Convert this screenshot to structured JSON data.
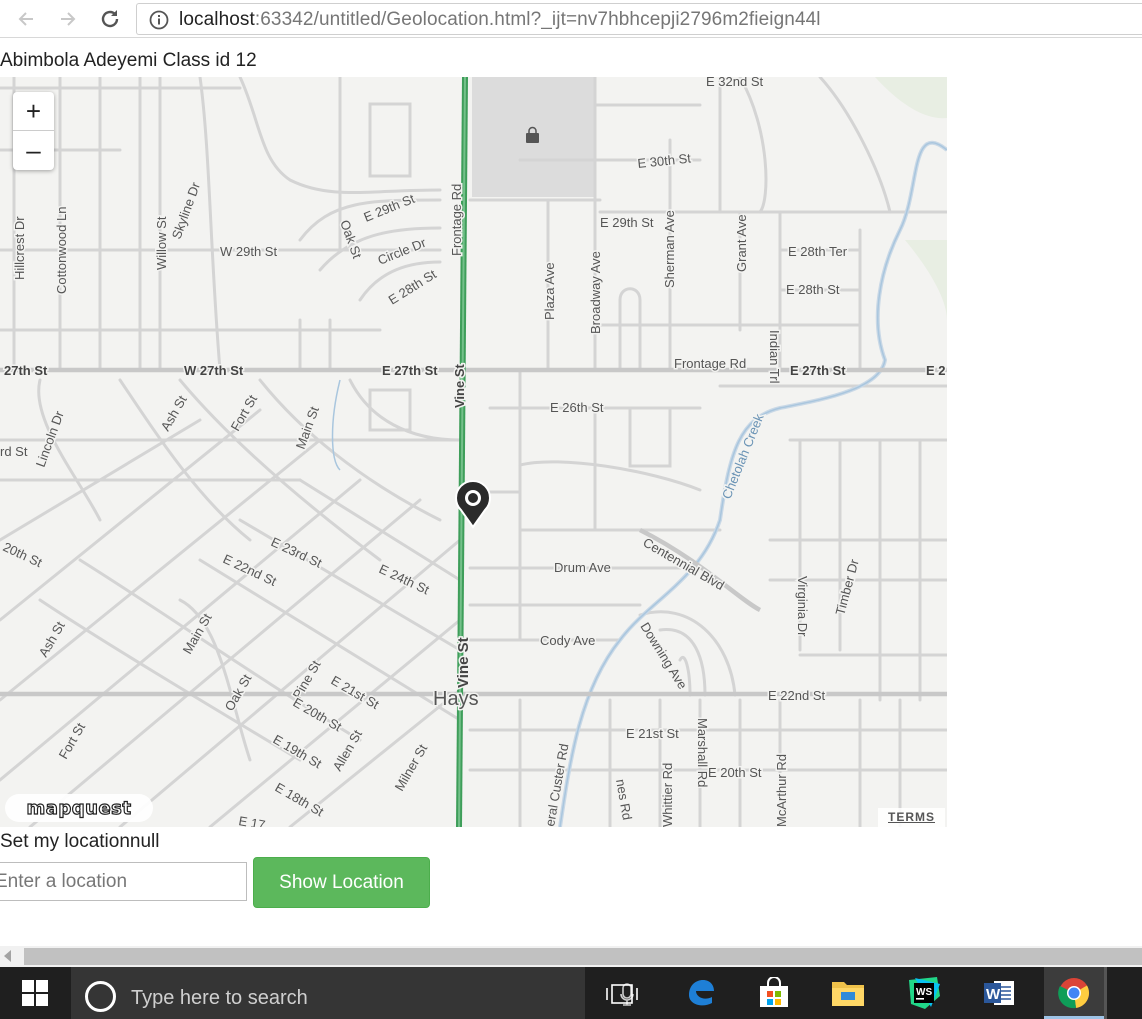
{
  "browser": {
    "url_host": "localhost",
    "url_rest": ":63342/untitled/Geolocation.html?_ijt=nv7hbhcepji2796m2fieign44l",
    "back_icon": "arrow-left-icon",
    "forward_icon": "arrow-right-icon",
    "reload_icon": "reload-icon",
    "info_icon": "info-circle-icon"
  },
  "page": {
    "heading": "Abimbola Adeyemi Class id 12",
    "set_location_text": "Set my locationnull",
    "location_input_placeholder": "Enter a location",
    "show_location_label": "Show Location"
  },
  "map": {
    "provider_logo": "mapquest",
    "terms_label": "TERMS",
    "zoom_in_label": "+",
    "zoom_out_label": "–",
    "city_label": "Hays",
    "street_labels": [
      "E 32nd St",
      "E 30th St",
      "E 29th St",
      "E 29th St",
      "Circle Dr",
      "E 28th St",
      "W 29th St",
      "E 28th Ter",
      "E 28th St",
      "Hillcrest Dr",
      "Cottonwood Ln",
      "Willow St",
      "Skyline Dr",
      "Oak St",
      "Frontage Rd",
      "Plaza Ave",
      "Broadway Ave",
      "Sherman Ave",
      "Grant Ave",
      "27th St",
      "W 27th St",
      "E 27th St",
      "Frontage Rd",
      "E 27th St",
      "Indian Trl",
      "E 26th St",
      "Chetolah Creek",
      "Lincoln Dr",
      "Ash St",
      "Fort St",
      "Main St",
      "Vine St",
      "E 23rd St",
      "E 24th St",
      "E 22nd St",
      "Drum Ave",
      "Centennial Blvd",
      "Cody Ave",
      "Downing Ave",
      "Virginia Dr",
      "Timber Dr",
      "Vine St",
      "E 22nd St",
      "E 21st St",
      "E 20th St",
      "Marshall Rd",
      "Whittier Rd",
      "McArthur Rd",
      "Oak St",
      "Pine St",
      "E 21st St",
      "E 20th St",
      "Allen St",
      "E 19th St",
      "Milner St",
      "E 18th St",
      "Ash St",
      "Main St",
      "Fort St",
      "20th St",
      "rd St",
      "E 2",
      "E 17",
      "eral Custer Rd",
      "nes Rd"
    ],
    "marker_icon": "location-pin-icon"
  },
  "taskbar": {
    "search_placeholder": "Type here to search",
    "start_icon": "windows-start-icon",
    "cortana_icon": "cortana-circle-icon",
    "mic_icon": "microphone-icon",
    "task_view_icon": "task-view-icon",
    "apps": [
      {
        "name": "edge-icon",
        "label": "e"
      },
      {
        "name": "store-icon",
        "label": ""
      },
      {
        "name": "file-explorer-icon",
        "label": ""
      },
      {
        "name": "webstorm-icon",
        "label": "WS"
      },
      {
        "name": "word-icon",
        "label": "W"
      },
      {
        "name": "chrome-icon",
        "label": ""
      }
    ]
  },
  "colors": {
    "button_green": "#5cb85c",
    "map_highlight_route": "#3e9e5a",
    "taskbar": "#1f1f1f"
  }
}
